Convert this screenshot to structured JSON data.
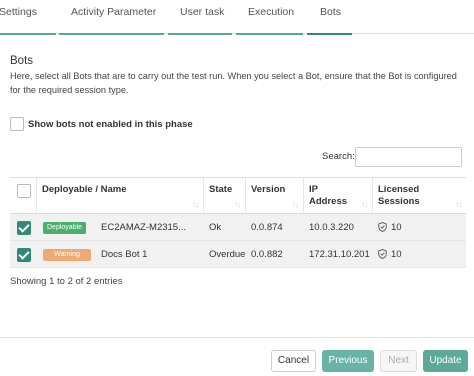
{
  "tabs": [
    {
      "label": "Settings"
    },
    {
      "label": "Activity Parameter"
    },
    {
      "label": "User task"
    },
    {
      "label": "Execution"
    },
    {
      "label": "Bots"
    }
  ],
  "active_tab": "Bots",
  "section": {
    "title": "Bots",
    "description": "Here, select all Bots that are to carry out the test run. When you select a Bot, ensure that the Bot is configured for the required session type."
  },
  "filter": {
    "label": "Show bots not enabled in this phase",
    "checked": false
  },
  "search": {
    "label": "Search:",
    "value": "",
    "placeholder": ""
  },
  "table": {
    "columns": [
      {
        "label": "Deployable / Name"
      },
      {
        "label": "State"
      },
      {
        "label": "Version"
      },
      {
        "label": "IP Address"
      },
      {
        "label": "Licensed Sessions"
      }
    ],
    "rows": [
      {
        "selected": true,
        "badge": "Deployable",
        "name": "EC2AMAZ-M2315...",
        "state": "Ok",
        "version": "0.0.874",
        "ip": "10.0.3.220",
        "sessions": "10"
      },
      {
        "selected": true,
        "badge": "Warning",
        "name": "Docs Bot 1",
        "state": "Overdue",
        "version": "0.0.882",
        "ip": "172.31.10.201",
        "sessions": "10"
      }
    ]
  },
  "info": "Showing 1 to 2 of 2 entries",
  "buttons": {
    "cancel": "Cancel",
    "previous": "Previous",
    "next": "Next",
    "update": "Update"
  },
  "colors": {
    "accent": "#2f8a7b",
    "deployable": "#4aae6e",
    "warning": "#eeaa72",
    "button_green": "#5aa999"
  },
  "icons": {
    "sort": "sort-arrows-icon",
    "sessions": "shield-check-icon",
    "check": "checkmark-icon"
  }
}
